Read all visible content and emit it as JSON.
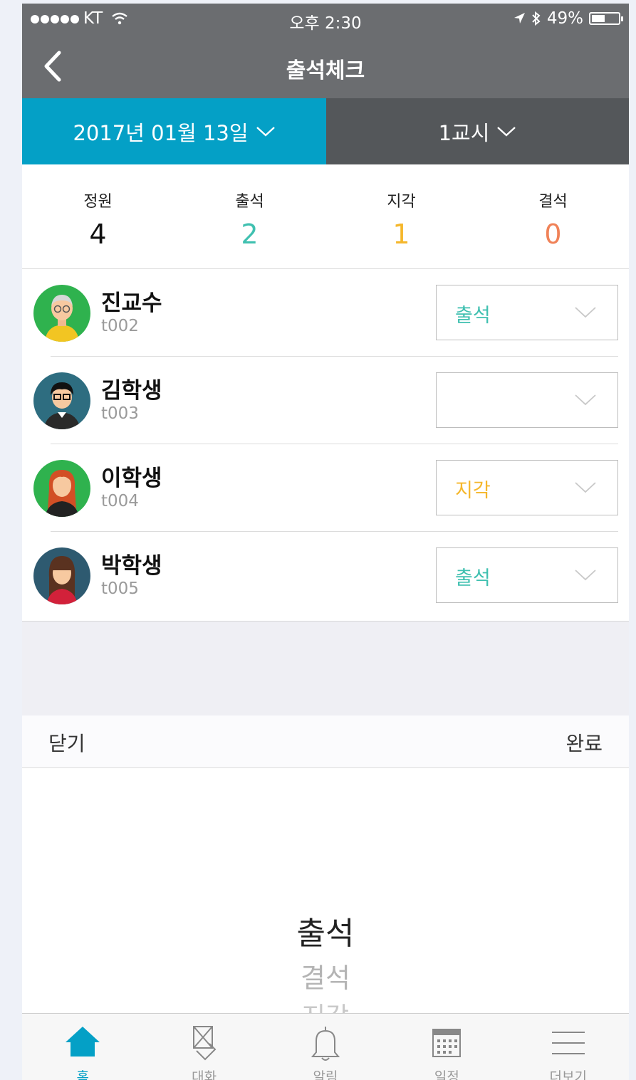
{
  "status_bar": {
    "carrier": "KT",
    "time": "오후 2:30",
    "battery": "49%",
    "battery_level": 0.49
  },
  "nav": {
    "title": "출석체크"
  },
  "selector": {
    "date": "2017년 01월 13일",
    "period": "1교시"
  },
  "summary": {
    "capacity": {
      "label": "정원",
      "value": "4",
      "color": "#111111"
    },
    "present": {
      "label": "출석",
      "value": "2",
      "color": "#3fc0b0"
    },
    "late": {
      "label": "지각",
      "value": "1",
      "color": "#f5b72c"
    },
    "absent": {
      "label": "결석",
      "value": "0",
      "color": "#f08258"
    }
  },
  "students": [
    {
      "name": "진교수",
      "id": "t002",
      "status": "출석",
      "status_color": "#3fc0b0",
      "avatar_bg": "#2fb24e"
    },
    {
      "name": "김학생",
      "id": "t003",
      "status": "",
      "status_color": "#333333",
      "avatar_bg": "#2e6d80"
    },
    {
      "name": "이학생",
      "id": "t004",
      "status": "지각",
      "status_color": "#f5b72c",
      "avatar_bg": "#2fb24e"
    },
    {
      "name": "박학생",
      "id": "t005",
      "status": "출석",
      "status_color": "#3fc0b0",
      "avatar_bg": "#2e5a70"
    }
  ],
  "picker": {
    "close_label": "닫기",
    "done_label": "완료",
    "options": [
      "출석",
      "결석",
      "지각"
    ]
  },
  "tabbar": {
    "items": [
      {
        "label": "홈",
        "icon": "home-icon",
        "active": true
      },
      {
        "label": "대화",
        "icon": "chat-icon",
        "active": false
      },
      {
        "label": "알림",
        "icon": "bell-icon",
        "active": false
      },
      {
        "label": "일정",
        "icon": "calendar-icon",
        "active": false
      },
      {
        "label": "더보기",
        "icon": "menu-icon",
        "active": false
      }
    ]
  },
  "colors": {
    "accent": "#04a0c6",
    "nav_bg": "#6b6d70",
    "period_bg": "#54575a"
  }
}
